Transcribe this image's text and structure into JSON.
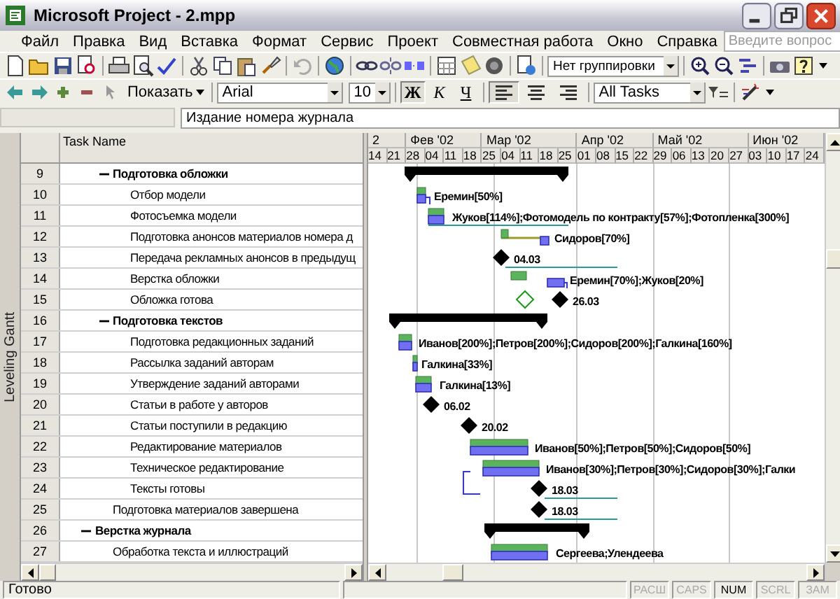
{
  "window": {
    "title": "Microsoft Project - 2.mpp"
  },
  "menu": [
    {
      "label": "Файл"
    },
    {
      "label": "Правка"
    },
    {
      "label": "Вид"
    },
    {
      "label": "Вставка"
    },
    {
      "label": "Формат"
    },
    {
      "label": "Сервис"
    },
    {
      "label": "Проект"
    },
    {
      "label": "Совместная работа"
    },
    {
      "label": "Окно"
    },
    {
      "label": "Справка"
    }
  ],
  "help_search": {
    "placeholder": "Введите вопрос"
  },
  "standard_toolbar": {
    "grouping": "Нет группировки"
  },
  "formatting_toolbar": {
    "show_label": "Показать",
    "font": "Arial",
    "size": "10",
    "filter": "All Tasks",
    "style_buttons": [
      {
        "label": "Ж",
        "selected": true
      },
      {
        "label": "К",
        "selected": false
      },
      {
        "label": "Ч",
        "selected": false
      }
    ],
    "align_buttons": [
      {
        "kind": "left",
        "selected": true
      },
      {
        "kind": "center",
        "selected": false
      },
      {
        "kind": "right",
        "selected": false
      }
    ]
  },
  "entry_bar": {
    "value": "Издание номера журнала"
  },
  "view_bar": {
    "label": "Leveling Gantt"
  },
  "table": {
    "columns": [
      "Task Name"
    ],
    "tasks": [
      {
        "children": [
          {
            "id": "9",
            "name": "Подготовка обложки",
            "expanded": true,
            "kind": "summary",
            "children": [
              {
                "id": "10",
                "name": "Отбор модели",
                "kind": "task",
                "label": "Еремин[50%]"
              },
              {
                "id": "11",
                "name": "Фотосъемка модели",
                "kind": "task",
                "label": "Жуков[114%];Фотомодель по контракту[57%];Фотопленка[300%]"
              },
              {
                "id": "12",
                "name": "Подготовка анонсов материалов номера д",
                "kind": "task",
                "label": "Сидоров[70%]"
              },
              {
                "id": "13",
                "name": "Передача рекламных анонсов в предыдущ",
                "kind": "milestone",
                "label": "04.03"
              },
              {
                "id": "14",
                "name": "Верстка обложки",
                "kind": "task",
                "label": "Еремин[70%];Жуков[20%]"
              },
              {
                "id": "15",
                "name": "Обложка готова",
                "kind": "milestone",
                "label": "26.03"
              }
            ]
          },
          {
            "id": "16",
            "name": "Подготовка текстов",
            "expanded": true,
            "kind": "summary",
            "children": [
              {
                "id": "17",
                "name": "Подготовка редакционных заданий",
                "kind": "task",
                "label": "Иванов[200%];Петров[200%];Сидоров[200%];Галкина[160%]"
              },
              {
                "id": "18",
                "name": "Рассылка заданий авторам",
                "kind": "task",
                "label": "Галкина[33%]"
              },
              {
                "id": "19",
                "name": "Утверждение заданий авторами",
                "kind": "task",
                "label": "Галкина[13%]"
              },
              {
                "id": "20",
                "name": "Статьи в работе у авторов",
                "kind": "milestone",
                "label": "06.02"
              },
              {
                "id": "21",
                "name": "Статьи поступили в редакцию",
                "kind": "milestone",
                "label": "20.02"
              },
              {
                "id": "22",
                "name": "Редактирование материалов",
                "kind": "task",
                "label": "Иванов[50%];Петров[50%];Сидоров[50%]"
              },
              {
                "id": "23",
                "name": "Техническое редактирование",
                "kind": "task",
                "label": "Иванов[30%];Петров[30%];Сидоров[30%];Галки"
              },
              {
                "id": "24",
                "name": "Тексты готовы",
                "kind": "milestone",
                "label": "18.03"
              }
            ]
          },
          {
            "id": "25",
            "name": "Подготовка материалов завершена",
            "kind": "milestone",
            "label": "18.03"
          }
        ]
      },
      {
        "id": "26",
        "name": "Верстка журнала",
        "expanded": true,
        "kind": "summary",
        "children": [
          {
            "id": "27",
            "name": "Обработка текста и иллюстраций",
            "kind": "task",
            "label": "Сергеева;Улендеева"
          }
        ]
      }
    ]
  },
  "timescale": {
    "months": [
      "2",
      "Фев '02",
      "Мар '02",
      "Апр '02",
      "Май '02",
      "Июн '02"
    ],
    "weeks": [
      "14",
      "21",
      "28",
      "04",
      "11",
      "18",
      "25",
      "04",
      "11",
      "18",
      "25",
      "01",
      "08",
      "15",
      "22",
      "29",
      "06",
      "13",
      "20",
      "27",
      "03",
      "10",
      "17",
      "24"
    ]
  },
  "status_bar": {
    "text": "Готово",
    "indicators": [
      {
        "label": "РАСШ",
        "on": false
      },
      {
        "label": "CAPS",
        "on": false
      },
      {
        "label": "NUM",
        "on": true
      },
      {
        "label": "SCRL",
        "on": false
      },
      {
        "label": "ЗАМ",
        "on": false
      }
    ]
  }
}
